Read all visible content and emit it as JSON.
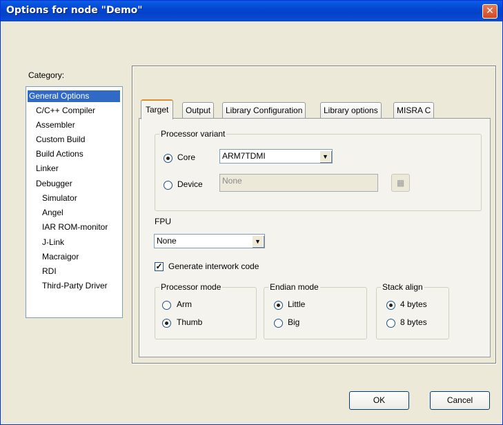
{
  "window": {
    "title": "Options for node \"Demo\"",
    "close_glyph": "✕"
  },
  "category": {
    "label": "Category:",
    "items": [
      {
        "label": "General Options",
        "selected": true
      },
      {
        "label": "C/C++ Compiler"
      },
      {
        "label": "Assembler"
      },
      {
        "label": "Custom Build"
      },
      {
        "label": "Build Actions"
      },
      {
        "label": "Linker"
      },
      {
        "label": "Debugger"
      },
      {
        "label": "Simulator"
      },
      {
        "label": "Angel"
      },
      {
        "label": "IAR ROM-monitor"
      },
      {
        "label": "J-Link"
      },
      {
        "label": "Macraigor"
      },
      {
        "label": "RDI"
      },
      {
        "label": "Third-Party Driver"
      }
    ]
  },
  "tabs": [
    {
      "label": "Target",
      "active": true
    },
    {
      "label": "Output"
    },
    {
      "label": "Library Configuration"
    },
    {
      "label": "Library options"
    },
    {
      "label": "MISRA C"
    }
  ],
  "processor_variant": {
    "title": "Processor variant",
    "core_label": "Core",
    "core_value": "ARM7TDMI",
    "device_label": "Device",
    "device_value": "None",
    "selected": "core",
    "device_button_icon": "device-list-icon"
  },
  "fpu": {
    "label": "FPU",
    "value": "None"
  },
  "interwork": {
    "label": "Generate interwork code",
    "checked": true
  },
  "processor_mode": {
    "title": "Processor mode",
    "options": [
      "Arm",
      "Thumb"
    ],
    "selected": "Thumb"
  },
  "endian_mode": {
    "title": "Endian mode",
    "options": [
      "Little",
      "Big"
    ],
    "selected": "Little"
  },
  "stack_align": {
    "title": "Stack align",
    "options": [
      "4 bytes",
      "8 bytes"
    ],
    "selected": "4 bytes"
  },
  "buttons": {
    "ok": "OK",
    "cancel": "Cancel"
  },
  "colors": {
    "titlebar": "#0446d1",
    "selection": "#316ac5",
    "dialog_bg": "#ece9d8"
  }
}
